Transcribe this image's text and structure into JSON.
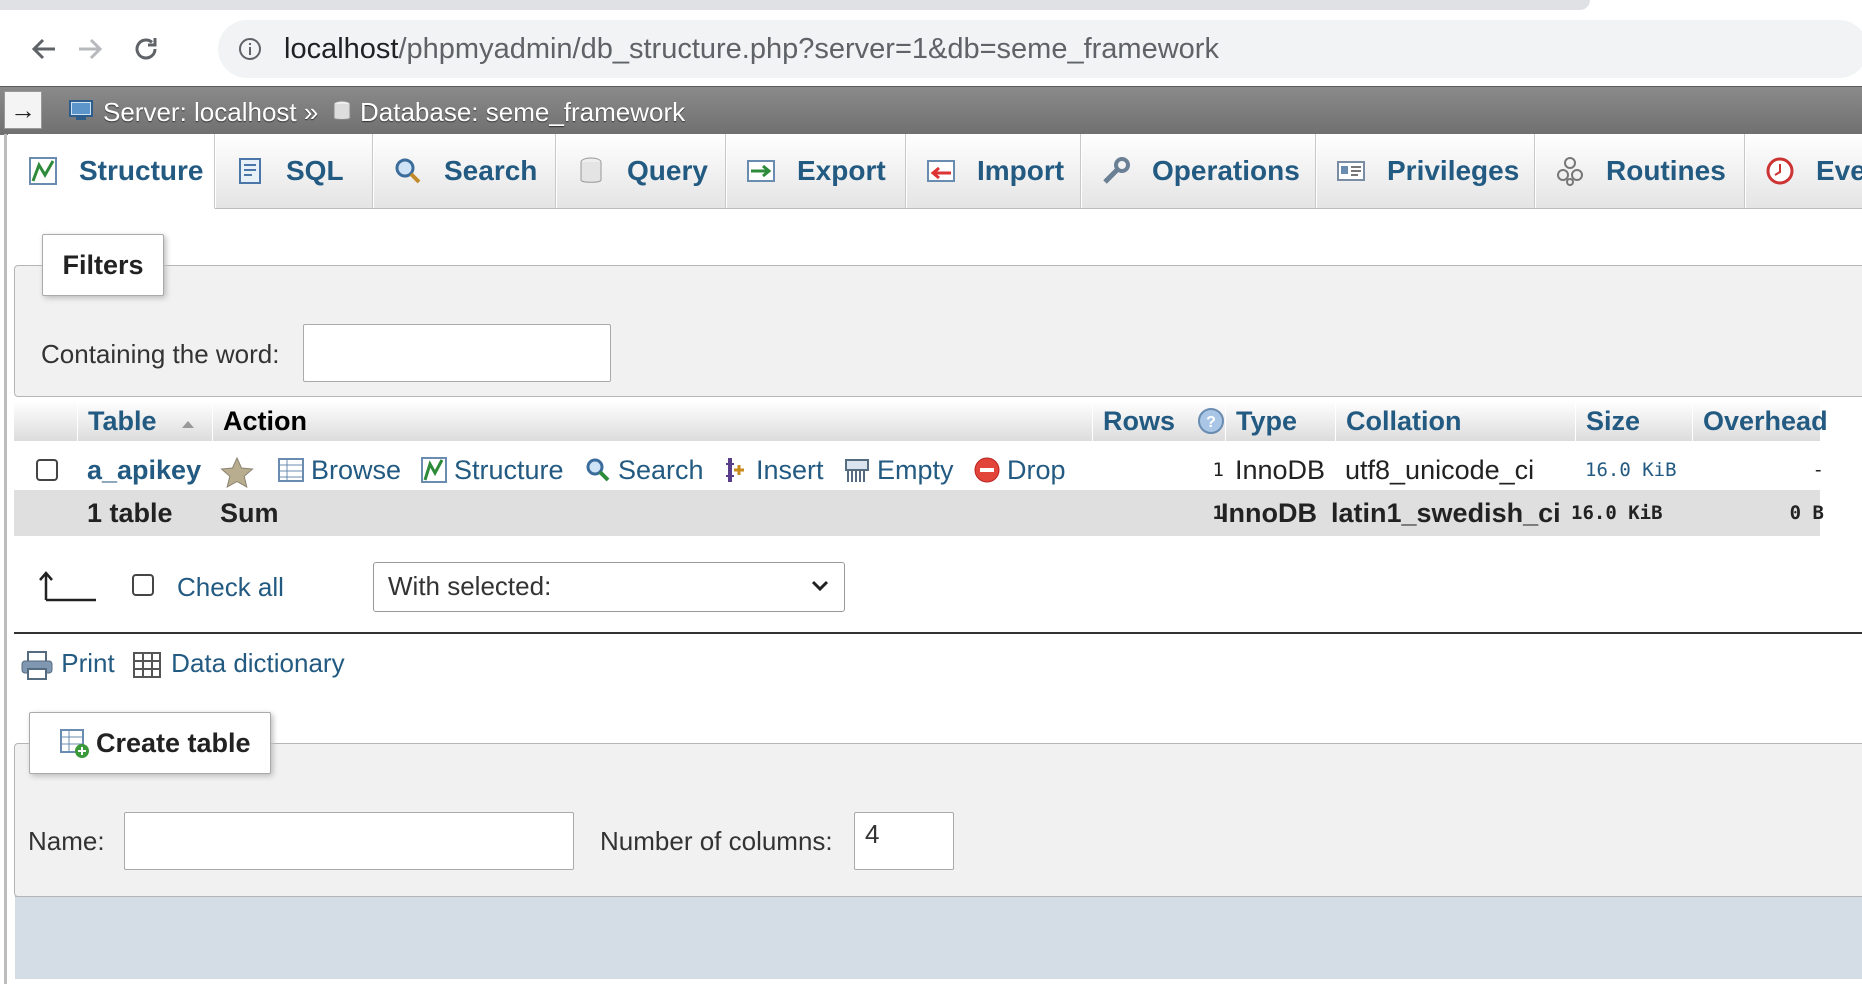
{
  "browser": {
    "url_host": "localhost",
    "url_path": "/phpmyadmin/db_structure.php?server=1&db=seme_framework"
  },
  "breadcrumb": {
    "server": "Server: localhost",
    "separator": "»",
    "database": "Database: seme_framework"
  },
  "tabs": [
    {
      "label": "Structure",
      "icon": "structure-icon",
      "active": true
    },
    {
      "label": "SQL",
      "icon": "sql-icon"
    },
    {
      "label": "Search",
      "icon": "search-icon"
    },
    {
      "label": "Query",
      "icon": "query-icon"
    },
    {
      "label": "Export",
      "icon": "export-icon"
    },
    {
      "label": "Import",
      "icon": "import-icon"
    },
    {
      "label": "Operations",
      "icon": "wrench-icon"
    },
    {
      "label": "Privileges",
      "icon": "privileges-icon"
    },
    {
      "label": "Routines",
      "icon": "routines-icon"
    },
    {
      "label": "Eve",
      "icon": "events-icon"
    }
  ],
  "filters": {
    "legend": "Filters",
    "containing_label": "Containing the word:",
    "containing_value": ""
  },
  "table": {
    "headers": {
      "table": "Table",
      "action": "Action",
      "rows": "Rows",
      "type": "Type",
      "collation": "Collation",
      "size": "Size",
      "overhead": "Overhead"
    },
    "rows": [
      {
        "name": "a_apikey",
        "actions": [
          "Browse",
          "Structure",
          "Search",
          "Insert",
          "Empty",
          "Drop"
        ],
        "rows": "1",
        "type": "InnoDB",
        "collation": "utf8_unicode_ci",
        "size": "16.0 KiB",
        "overhead": "-"
      }
    ],
    "summary": {
      "name": "1 table",
      "action": "Sum",
      "rows": "1",
      "type": "InnoDB",
      "collation": "latin1_swedish_ci",
      "size": "16.0 KiB",
      "overhead": "0 B"
    }
  },
  "bulk": {
    "check_all": "Check all",
    "with_selected": "With selected:"
  },
  "footer_links": {
    "print": "Print",
    "data_dictionary": "Data dictionary"
  },
  "create_table": {
    "legend": "Create table",
    "name_label": "Name:",
    "name_value": "",
    "columns_label": "Number of columns:",
    "columns_value": "4"
  }
}
